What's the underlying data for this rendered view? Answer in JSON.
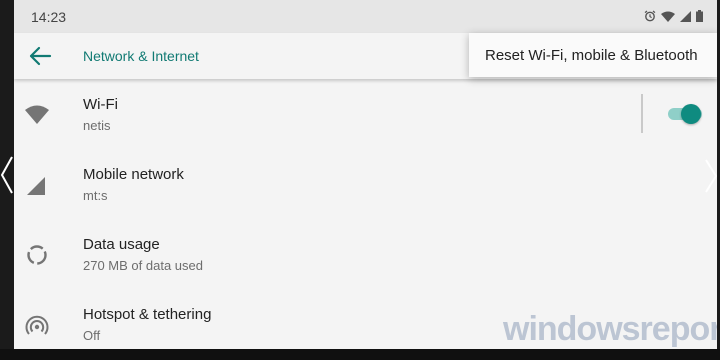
{
  "status_bar": {
    "time": "14:23",
    "icons": [
      "alarm-icon",
      "wifi-icon",
      "signal-icon",
      "battery-icon"
    ]
  },
  "toolbar": {
    "back_icon": "arrow-left-icon",
    "title": "Network & Internet"
  },
  "overflow_menu": {
    "items": [
      {
        "label": "Reset Wi-Fi, mobile & Bluetooth"
      }
    ]
  },
  "settings": {
    "items": [
      {
        "title": "Wi-Fi",
        "subtitle": "netis",
        "icon": "wifi-icon",
        "toggle_on": true
      },
      {
        "title": "Mobile network",
        "subtitle": "mt:s",
        "icon": "signal-icon"
      },
      {
        "title": "Data usage",
        "subtitle": "270 MB of data used",
        "icon": "data-usage-icon"
      },
      {
        "title": "Hotspot & tethering",
        "subtitle": "Off",
        "icon": "hotspot-icon"
      }
    ]
  },
  "watermark": {
    "text": "windowsreport"
  },
  "colors": {
    "accent": "#117a73",
    "toggle_thumb": "#0f8b80",
    "toggle_track": "#8fcfc8",
    "background": "#f4f4f4",
    "status_bar": "#e6e6e6"
  }
}
